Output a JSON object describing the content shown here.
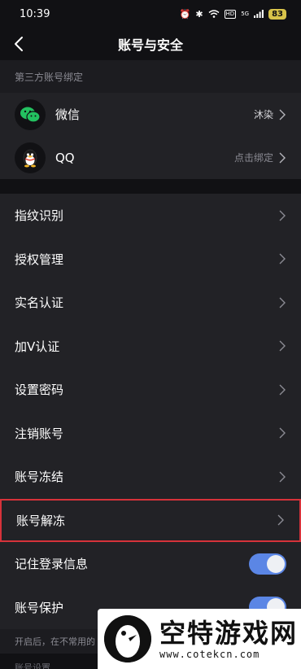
{
  "status_bar": {
    "time": "10:39",
    "signal": "5G",
    "battery": "83"
  },
  "nav": {
    "title": "账号与安全"
  },
  "third_party": {
    "header": "第三方账号绑定",
    "items": [
      {
        "label": "微信",
        "value": "沐染",
        "icon": "wechat-icon"
      },
      {
        "label": "QQ",
        "value": "点击绑定",
        "icon": "qq-icon"
      }
    ]
  },
  "menu": {
    "items": [
      {
        "label": "指纹识别"
      },
      {
        "label": "授权管理"
      },
      {
        "label": "实名认证"
      },
      {
        "label": "加V认证"
      },
      {
        "label": "设置密码"
      },
      {
        "label": "注销账号"
      },
      {
        "label": "账号冻结"
      },
      {
        "label": "账号解冻"
      }
    ]
  },
  "toggles": {
    "items": [
      {
        "label": "记住登录信息",
        "on": true
      },
      {
        "label": "账号保护",
        "on": true
      }
    ]
  },
  "footer": {
    "note": "开启后，在不常用的",
    "note2": "账号设置"
  },
  "watermark": {
    "title": "空特游戏网",
    "url": "www.cotekcn.com"
  },
  "colors": {
    "background": "#111114",
    "row": "#222226",
    "toggle_on": "#5b86e5",
    "highlight": "#d6323a",
    "wechat": "#23c160"
  }
}
